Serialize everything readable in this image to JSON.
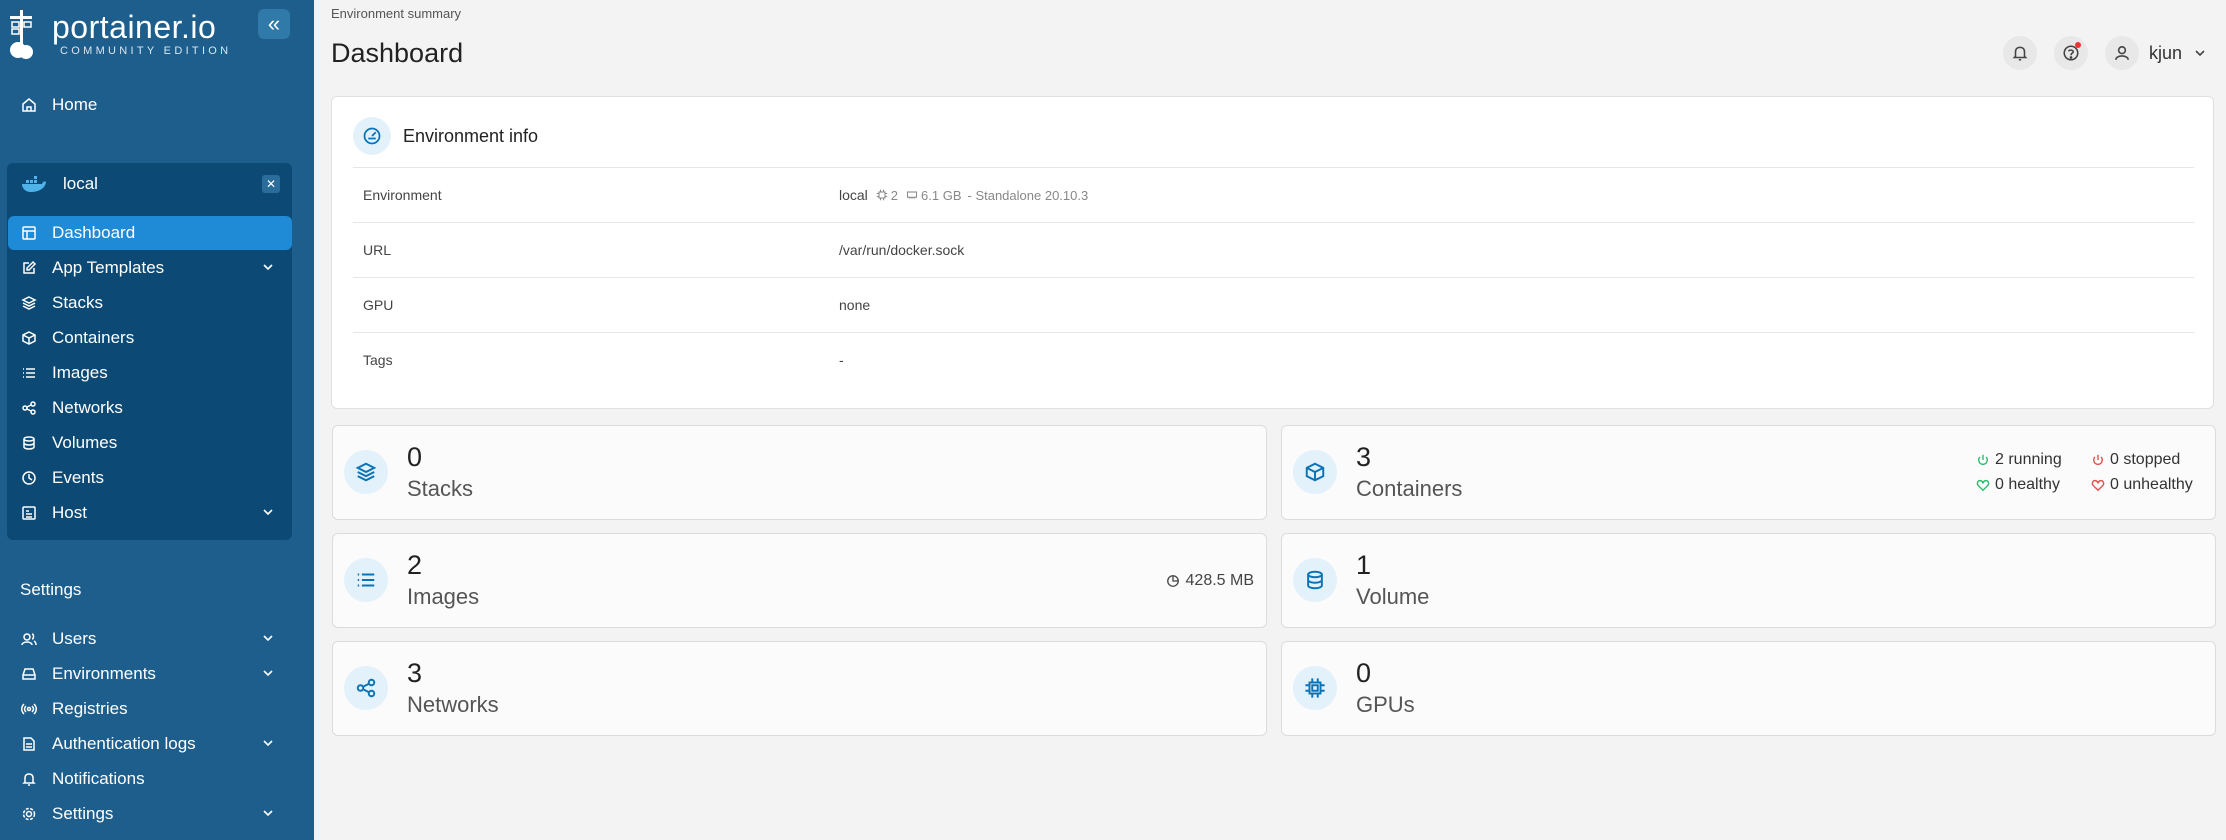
{
  "app": {
    "logo_title": "portainer.io",
    "logo_subtitle": "COMMUNITY EDITION"
  },
  "sidebar": {
    "home": "Home",
    "environment_name": "local",
    "env_items": [
      {
        "label": "Dashboard",
        "icon": "dashboard-icon"
      },
      {
        "label": "App Templates",
        "icon": "edit-icon"
      },
      {
        "label": "Stacks",
        "icon": "layers-icon"
      },
      {
        "label": "Containers",
        "icon": "box-icon"
      },
      {
        "label": "Images",
        "icon": "list-icon"
      },
      {
        "label": "Networks",
        "icon": "share-icon"
      },
      {
        "label": "Volumes",
        "icon": "database-icon"
      },
      {
        "label": "Events",
        "icon": "clock-icon"
      },
      {
        "label": "Host",
        "icon": "host-icon"
      }
    ],
    "settings_heading": "Settings",
    "settings_items": [
      {
        "label": "Users",
        "icon": "users-icon"
      },
      {
        "label": "Environments",
        "icon": "hdd-icon"
      },
      {
        "label": "Registries",
        "icon": "radio-icon"
      },
      {
        "label": "Authentication logs",
        "icon": "file-icon"
      },
      {
        "label": "Notifications",
        "icon": "bell-icon"
      },
      {
        "label": "Settings",
        "icon": "gear-icon"
      }
    ]
  },
  "header": {
    "breadcrumb": "Environment summary",
    "title": "Dashboard",
    "user": "kjun"
  },
  "env_info": {
    "title": "Environment info",
    "rows": [
      {
        "key": "Environment",
        "value": "local",
        "cpu": "2",
        "memory": "6.1 GB",
        "detail": "- Standalone 20.10.3"
      },
      {
        "key": "URL",
        "value": "/var/run/docker.sock"
      },
      {
        "key": "GPU",
        "value": "none"
      },
      {
        "key": "Tags",
        "value": "-"
      }
    ]
  },
  "stats": {
    "stacks": {
      "count": "0",
      "label": "Stacks"
    },
    "containers": {
      "count": "3",
      "label": "Containers",
      "running": "2 running",
      "stopped": "0 stopped",
      "healthy": "0 healthy",
      "unhealthy": "0 unhealthy"
    },
    "images": {
      "count": "2",
      "label": "Images",
      "size": "428.5 MB"
    },
    "volumes": {
      "count": "1",
      "label": "Volume"
    },
    "networks": {
      "count": "3",
      "label": "Networks"
    },
    "gpus": {
      "count": "0",
      "label": "GPUs"
    }
  },
  "colors": {
    "sidebar": "#1d5e8c",
    "env_panel": "#0c4a75",
    "active": "#1f8ad6",
    "accent": "#0b72b5",
    "green": "#2dba6e",
    "red": "#d9534f"
  }
}
